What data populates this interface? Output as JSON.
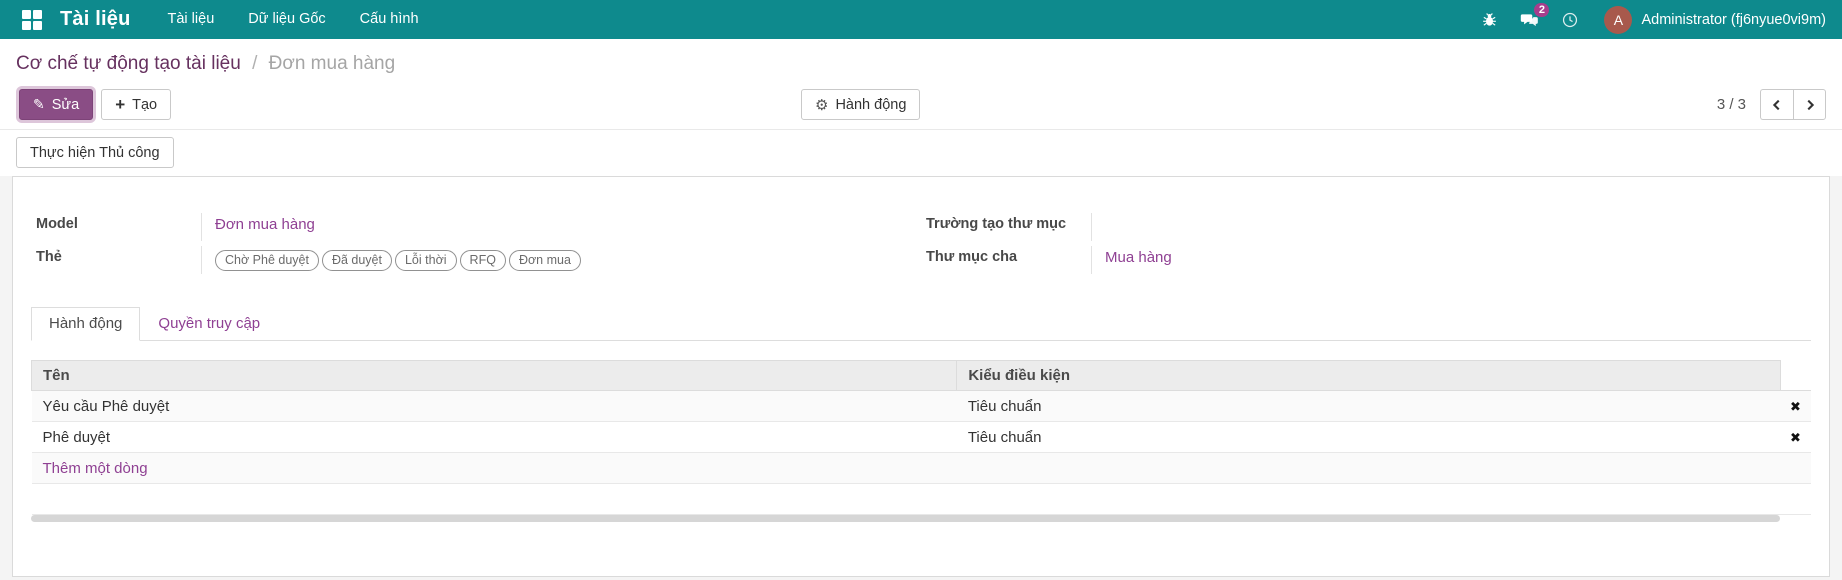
{
  "topbar": {
    "app_name": "Tài liệu",
    "menus": [
      {
        "label": "Tài liệu"
      },
      {
        "label": "Dữ liệu Gốc"
      },
      {
        "label": "Cấu hình"
      }
    ],
    "message_badge": "2",
    "avatar_initial": "A",
    "user_name": "Administrator (fj6nyue0vi9m)"
  },
  "breadcrumb": {
    "parent": "Cơ chế tự động tạo tài liệu",
    "separator": "/",
    "current": "Đơn mua hàng"
  },
  "control_panel": {
    "edit_label": "Sửa",
    "create_label": "Tạo",
    "action_label": "Hành động",
    "pager_value": "3 / 3",
    "manual_label": "Thực hiện Thủ công"
  },
  "form": {
    "model_label": "Model",
    "model_value": "Đơn mua hàng",
    "tags_label": "Thẻ",
    "tags": [
      "Chờ Phê duyệt",
      "Đã duyệt",
      "Lỗi thời",
      "RFQ",
      "Đơn mua"
    ],
    "folder_field_label": "Trường tạo thư mục",
    "folder_field_value": "",
    "parent_folder_label": "Thư mục cha",
    "parent_folder_value": "Mua hàng"
  },
  "tabs": [
    {
      "label": "Hành động"
    },
    {
      "label": "Quyền truy cập"
    }
  ],
  "table": {
    "columns": {
      "name": "Tên",
      "condition": "Kiểu điều kiện"
    },
    "rows": [
      {
        "name": "Yêu cầu Phê duyệt",
        "condition": "Tiêu chuẩn"
      },
      {
        "name": "Phê duyệt",
        "condition": "Tiêu chuẩn"
      }
    ],
    "add_line_label": "Thêm một dòng"
  },
  "colors": {
    "topbar": "#0e8a8d",
    "primary_button": "#8a4d85",
    "link": "#8f4093",
    "badge": "#a73d8c",
    "avatar": "#a8594c"
  }
}
